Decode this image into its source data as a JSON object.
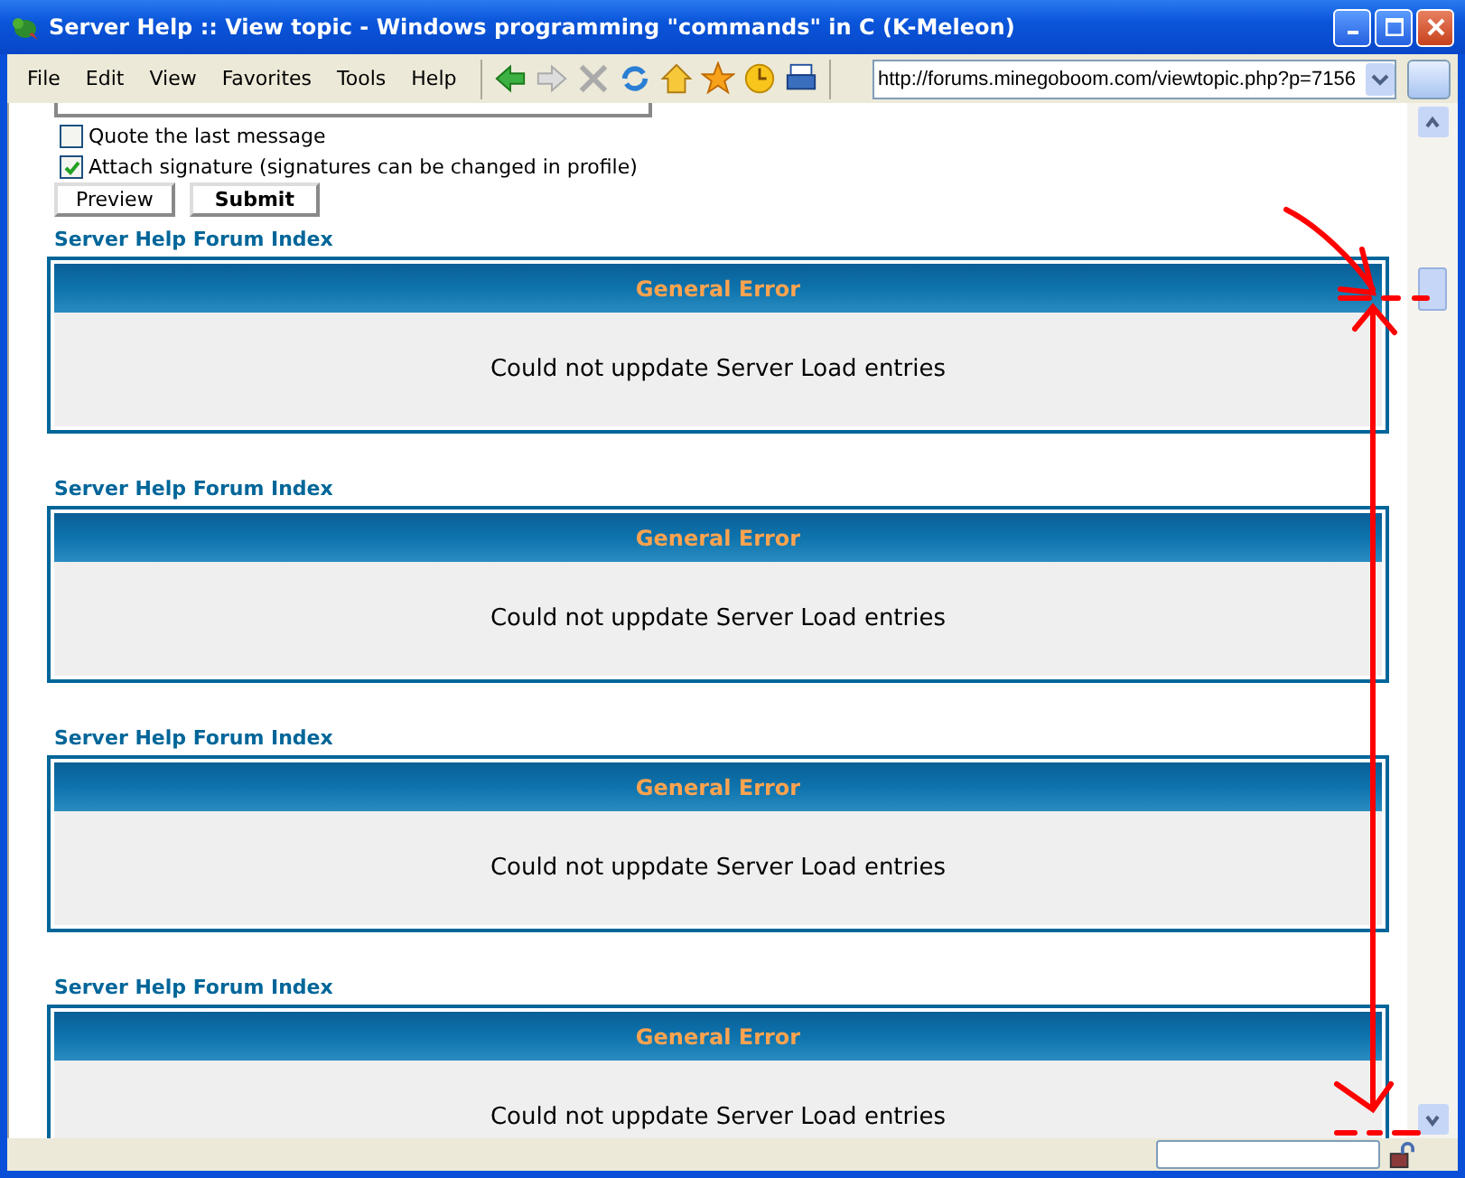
{
  "window": {
    "title": "Server Help :: View topic - Windows programming \"commands\" in C (K-Meleon)"
  },
  "menu": [
    {
      "label": "File"
    },
    {
      "label": "Edit"
    },
    {
      "label": "View"
    },
    {
      "label": "Favorites"
    },
    {
      "label": "Tools"
    },
    {
      "label": "Help"
    }
  ],
  "address": {
    "value": "http://forums.minegoboom.com/viewtopic.php?p=7156"
  },
  "options": [
    {
      "label": "Quote the last message",
      "checked": false
    },
    {
      "label": "Attach signature (signatures can be changed in profile)",
      "checked": true
    }
  ],
  "buttons": [
    {
      "label": "Preview",
      "kind": "normal"
    },
    {
      "label": "Submit",
      "kind": "primary"
    }
  ],
  "blocks": [
    {
      "link": "Server Help Forum Index",
      "header": "General Error",
      "message": "Could not uppdate Server Load entries"
    },
    {
      "link": "Server Help Forum Index",
      "header": "General Error",
      "message": "Could not uppdate Server Load entries"
    },
    {
      "link": "Server Help Forum Index",
      "header": "General Error",
      "message": "Could not uppdate Server Load entries"
    },
    {
      "link": "Server Help Forum Index",
      "header": "General Error",
      "message": "Could not uppdate Server Load entries"
    }
  ]
}
